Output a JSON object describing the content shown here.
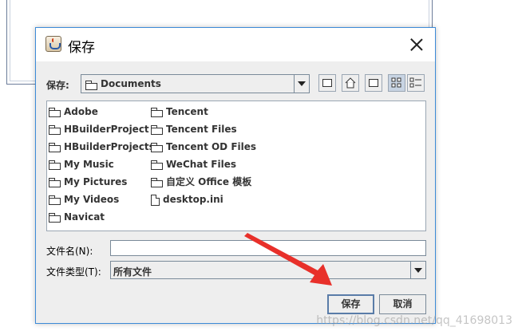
{
  "dialog": {
    "title": "保存",
    "save_in_label": "保存:",
    "current_dir": "Documents",
    "filename_label": "文件名(N):",
    "filename_value": "",
    "filetype_label": "文件类型(T):",
    "filetype_value": "所有文件",
    "save_button": "保存",
    "cancel_button": "取消"
  },
  "files": {
    "col1": [
      {
        "name": "Adobe",
        "type": "folder"
      },
      {
        "name": "HBuilderProject",
        "type": "folder"
      },
      {
        "name": "HBuilderProjects",
        "type": "folder"
      },
      {
        "name": "My Music",
        "type": "folder"
      },
      {
        "name": "My Pictures",
        "type": "folder"
      },
      {
        "name": "My Videos",
        "type": "folder"
      },
      {
        "name": "Navicat",
        "type": "folder"
      }
    ],
    "col2": [
      {
        "name": "Tencent",
        "type": "folder"
      },
      {
        "name": "Tencent Files",
        "type": "folder"
      },
      {
        "name": "Tencent OD Files",
        "type": "folder"
      },
      {
        "name": "WeChat Files",
        "type": "folder"
      },
      {
        "name": "自定义 Office 模板",
        "type": "folder"
      },
      {
        "name": "desktop.ini",
        "type": "file"
      }
    ]
  },
  "toolbar_icons": [
    "up-folder-icon",
    "home-icon",
    "new-folder-icon",
    "list-view-icon",
    "details-view-icon"
  ],
  "watermark": "https://blog.csdn.net/qq_41698013",
  "colors": {
    "dialog_bg": "#eeeeee",
    "border_accent": "#3c8bd8",
    "annotation_arrow": "#e8302a"
  }
}
